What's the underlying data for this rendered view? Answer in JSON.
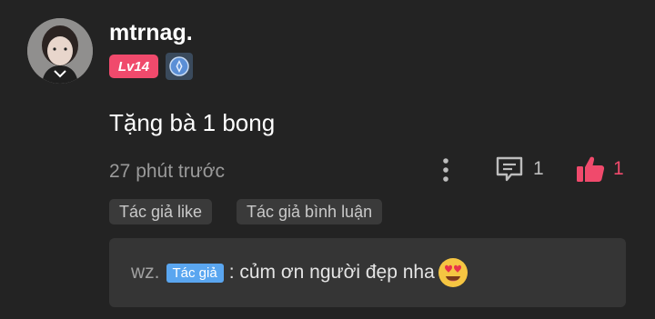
{
  "comment": {
    "username": "mtrnag.",
    "level": "Lv14",
    "text": "Tặng bà 1 bong",
    "timestamp": "27 phút trước",
    "reply_count": "1",
    "like_count": "1",
    "icons": {
      "avatar": "user-avatar",
      "rank": "rank-badge-icon",
      "more": "more-vertical-icon",
      "reply": "comment-icon",
      "like": "thumbs-up-icon"
    }
  },
  "tags": [
    "Tác giả like",
    "Tác giả bình luận"
  ],
  "reply": {
    "author": "wz.",
    "author_badge": "Tác giả",
    "text": ": củm ơn người đẹp nha",
    "emoji": "heart-eyes-emoji"
  },
  "colors": {
    "background": "#232323",
    "accent_pink": "#f04a6c",
    "badge_blue": "#5aa6f0",
    "muted_text": "#9a9a9a"
  }
}
